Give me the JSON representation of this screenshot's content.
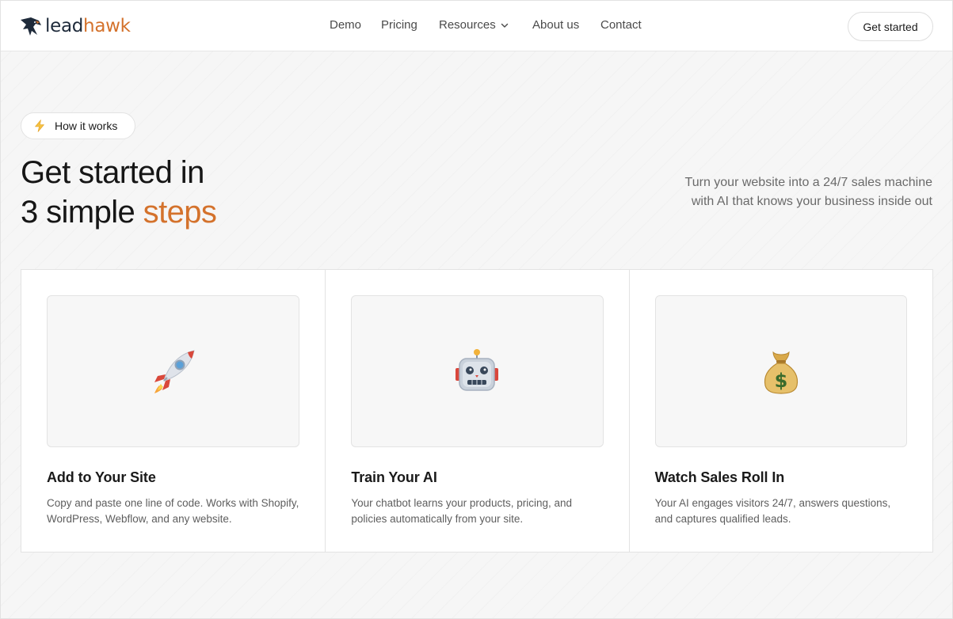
{
  "brand": {
    "name_part1": "lead",
    "name_part2": "hawk",
    "accent_color": "#d4722c",
    "dark_color": "#1e2a3a"
  },
  "nav": {
    "items": [
      {
        "label": "Demo"
      },
      {
        "label": "Pricing"
      },
      {
        "label": "Resources",
        "icon": "chevron-down-icon"
      },
      {
        "label": "About us"
      },
      {
        "label": "Contact"
      }
    ],
    "cta_label": "Get started"
  },
  "hero": {
    "badge_icon": "lightning-bolt-icon",
    "badge_label": "How it works",
    "headline_line1": "Get started in",
    "headline_line2_prefix": "3 simple ",
    "headline_line2_accent": "steps",
    "subtext": "Turn your website into a 24/7 sales machine with AI that knows your business inside out"
  },
  "steps": [
    {
      "icon": "rocket-icon",
      "title": "Add to Your Site",
      "description": "Copy and paste one line of code. Works with Shopify, WordPress, Webflow, and any website."
    },
    {
      "icon": "robot-icon",
      "title": "Train Your AI",
      "description": "Your chatbot learns your products, pricing, and policies automatically from your site."
    },
    {
      "icon": "money-bag-icon",
      "title": "Watch Sales Roll In",
      "description": "Your AI engages visitors 24/7, answers questions, and captures qualified leads."
    }
  ]
}
